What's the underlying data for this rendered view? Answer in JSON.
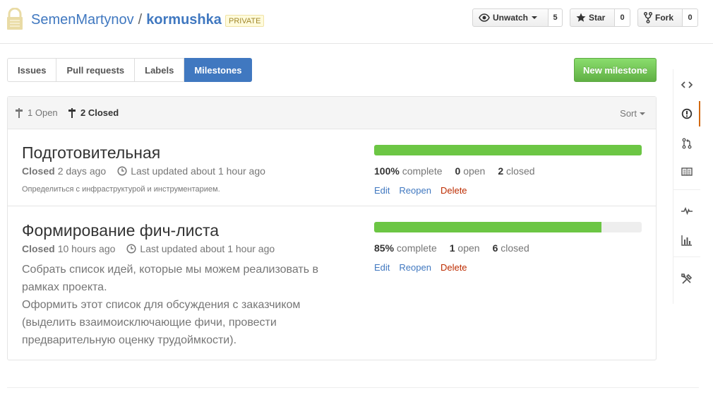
{
  "repo": {
    "owner": "SemenMartynov",
    "separator": "/",
    "name": "kormushka",
    "visibility": "PRIVATE"
  },
  "actions": {
    "watch": {
      "label": "Unwatch",
      "count": "5"
    },
    "star": {
      "label": "Star",
      "count": "0"
    },
    "fork": {
      "label": "Fork",
      "count": "0"
    }
  },
  "tabs": [
    {
      "label": "Issues"
    },
    {
      "label": "Pull requests"
    },
    {
      "label": "Labels"
    },
    {
      "label": "Milestones",
      "selected": true
    }
  ],
  "new_milestone_label": "New milestone",
  "states": {
    "open": {
      "count": "1",
      "label": "Open"
    },
    "closed": {
      "count": "2",
      "label": "Closed"
    }
  },
  "sort_label": "Sort",
  "milestones": [
    {
      "title": "Подготовительная",
      "state": "Closed",
      "closed_ago": "2 days ago",
      "updated": "Last updated about 1 hour ago",
      "description": "Определиться с инфраструктурой и инструментарием.",
      "progress": 100,
      "percent": "100%",
      "complete_label": "complete",
      "open_count": "0",
      "open_label": "open",
      "closed_count": "2",
      "closed_label": "closed",
      "edit": "Edit",
      "reopen": "Reopen",
      "delete": "Delete"
    },
    {
      "title": "Формирование фич-листа",
      "state": "Closed",
      "closed_ago": "10 hours ago",
      "updated": "Last updated about 1 hour ago",
      "description": "Собрать список идей, которые мы можем реализовать в рамках проекта.\nОформить этот список для обсуждения с заказчиком (выделить взаимоисключающие фичи, провести предварительную оценку трудоймкости).",
      "progress": 85,
      "percent": "85%",
      "complete_label": "complete",
      "open_count": "1",
      "open_label": "open",
      "closed_count": "6",
      "closed_label": "closed",
      "edit": "Edit",
      "reopen": "Reopen",
      "delete": "Delete"
    }
  ],
  "sidebar": [
    "code-icon",
    "issues-icon",
    "pull-request-icon",
    "wiki-icon",
    "pulse-icon",
    "graph-icon",
    "settings-icon"
  ],
  "colors": {
    "accent": "#4078c0",
    "success": "#6cc644",
    "danger": "#bd2c00",
    "private": "#a1882b",
    "selected_nav": "#d26911"
  }
}
